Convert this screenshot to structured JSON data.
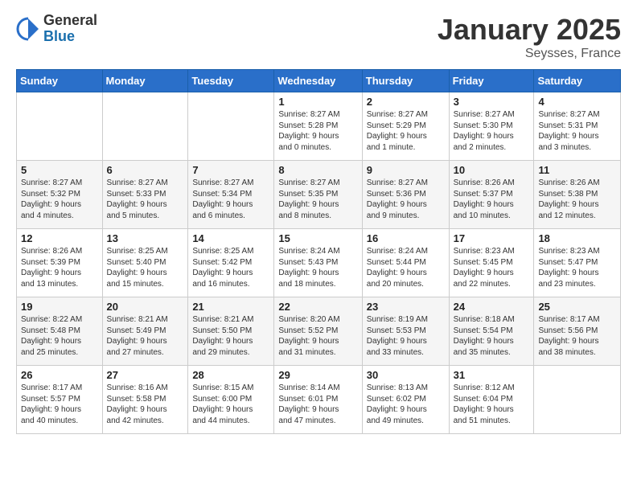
{
  "logo": {
    "general": "General",
    "blue": "Blue"
  },
  "header": {
    "month": "January 2025",
    "location": "Seysses, France"
  },
  "weekdays": [
    "Sunday",
    "Monday",
    "Tuesday",
    "Wednesday",
    "Thursday",
    "Friday",
    "Saturday"
  ],
  "weeks": [
    [
      {
        "day": "",
        "content": ""
      },
      {
        "day": "",
        "content": ""
      },
      {
        "day": "",
        "content": ""
      },
      {
        "day": "1",
        "content": "Sunrise: 8:27 AM\nSunset: 5:28 PM\nDaylight: 9 hours\nand 0 minutes."
      },
      {
        "day": "2",
        "content": "Sunrise: 8:27 AM\nSunset: 5:29 PM\nDaylight: 9 hours\nand 1 minute."
      },
      {
        "day": "3",
        "content": "Sunrise: 8:27 AM\nSunset: 5:30 PM\nDaylight: 9 hours\nand 2 minutes."
      },
      {
        "day": "4",
        "content": "Sunrise: 8:27 AM\nSunset: 5:31 PM\nDaylight: 9 hours\nand 3 minutes."
      }
    ],
    [
      {
        "day": "5",
        "content": "Sunrise: 8:27 AM\nSunset: 5:32 PM\nDaylight: 9 hours\nand 4 minutes."
      },
      {
        "day": "6",
        "content": "Sunrise: 8:27 AM\nSunset: 5:33 PM\nDaylight: 9 hours\nand 5 minutes."
      },
      {
        "day": "7",
        "content": "Sunrise: 8:27 AM\nSunset: 5:34 PM\nDaylight: 9 hours\nand 6 minutes."
      },
      {
        "day": "8",
        "content": "Sunrise: 8:27 AM\nSunset: 5:35 PM\nDaylight: 9 hours\nand 8 minutes."
      },
      {
        "day": "9",
        "content": "Sunrise: 8:27 AM\nSunset: 5:36 PM\nDaylight: 9 hours\nand 9 minutes."
      },
      {
        "day": "10",
        "content": "Sunrise: 8:26 AM\nSunset: 5:37 PM\nDaylight: 9 hours\nand 10 minutes."
      },
      {
        "day": "11",
        "content": "Sunrise: 8:26 AM\nSunset: 5:38 PM\nDaylight: 9 hours\nand 12 minutes."
      }
    ],
    [
      {
        "day": "12",
        "content": "Sunrise: 8:26 AM\nSunset: 5:39 PM\nDaylight: 9 hours\nand 13 minutes."
      },
      {
        "day": "13",
        "content": "Sunrise: 8:25 AM\nSunset: 5:40 PM\nDaylight: 9 hours\nand 15 minutes."
      },
      {
        "day": "14",
        "content": "Sunrise: 8:25 AM\nSunset: 5:42 PM\nDaylight: 9 hours\nand 16 minutes."
      },
      {
        "day": "15",
        "content": "Sunrise: 8:24 AM\nSunset: 5:43 PM\nDaylight: 9 hours\nand 18 minutes."
      },
      {
        "day": "16",
        "content": "Sunrise: 8:24 AM\nSunset: 5:44 PM\nDaylight: 9 hours\nand 20 minutes."
      },
      {
        "day": "17",
        "content": "Sunrise: 8:23 AM\nSunset: 5:45 PM\nDaylight: 9 hours\nand 22 minutes."
      },
      {
        "day": "18",
        "content": "Sunrise: 8:23 AM\nSunset: 5:47 PM\nDaylight: 9 hours\nand 23 minutes."
      }
    ],
    [
      {
        "day": "19",
        "content": "Sunrise: 8:22 AM\nSunset: 5:48 PM\nDaylight: 9 hours\nand 25 minutes."
      },
      {
        "day": "20",
        "content": "Sunrise: 8:21 AM\nSunset: 5:49 PM\nDaylight: 9 hours\nand 27 minutes."
      },
      {
        "day": "21",
        "content": "Sunrise: 8:21 AM\nSunset: 5:50 PM\nDaylight: 9 hours\nand 29 minutes."
      },
      {
        "day": "22",
        "content": "Sunrise: 8:20 AM\nSunset: 5:52 PM\nDaylight: 9 hours\nand 31 minutes."
      },
      {
        "day": "23",
        "content": "Sunrise: 8:19 AM\nSunset: 5:53 PM\nDaylight: 9 hours\nand 33 minutes."
      },
      {
        "day": "24",
        "content": "Sunrise: 8:18 AM\nSunset: 5:54 PM\nDaylight: 9 hours\nand 35 minutes."
      },
      {
        "day": "25",
        "content": "Sunrise: 8:17 AM\nSunset: 5:56 PM\nDaylight: 9 hours\nand 38 minutes."
      }
    ],
    [
      {
        "day": "26",
        "content": "Sunrise: 8:17 AM\nSunset: 5:57 PM\nDaylight: 9 hours\nand 40 minutes."
      },
      {
        "day": "27",
        "content": "Sunrise: 8:16 AM\nSunset: 5:58 PM\nDaylight: 9 hours\nand 42 minutes."
      },
      {
        "day": "28",
        "content": "Sunrise: 8:15 AM\nSunset: 6:00 PM\nDaylight: 9 hours\nand 44 minutes."
      },
      {
        "day": "29",
        "content": "Sunrise: 8:14 AM\nSunset: 6:01 PM\nDaylight: 9 hours\nand 47 minutes."
      },
      {
        "day": "30",
        "content": "Sunrise: 8:13 AM\nSunset: 6:02 PM\nDaylight: 9 hours\nand 49 minutes."
      },
      {
        "day": "31",
        "content": "Sunrise: 8:12 AM\nSunset: 6:04 PM\nDaylight: 9 hours\nand 51 minutes."
      },
      {
        "day": "",
        "content": ""
      }
    ]
  ]
}
